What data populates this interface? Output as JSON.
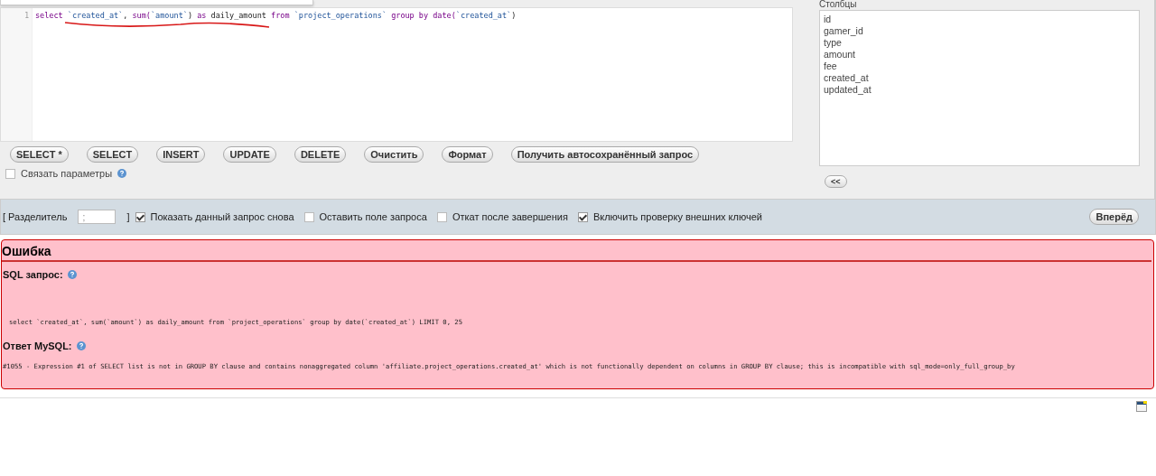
{
  "editor": {
    "line_number": "1",
    "tokens": [
      {
        "kind": "keyword",
        "text": "select "
      },
      {
        "kind": "ident",
        "text": "`created_at`"
      },
      {
        "kind": "plain",
        "text": ", "
      },
      {
        "kind": "keyword",
        "text": "sum("
      },
      {
        "kind": "ident",
        "text": "`amount`"
      },
      {
        "kind": "plain",
        "text": ") "
      },
      {
        "kind": "keyword",
        "text": "as "
      },
      {
        "kind": "plain",
        "text": "daily_amount "
      },
      {
        "kind": "keyword",
        "text": "from "
      },
      {
        "kind": "ident",
        "text": "`project_operations`"
      },
      {
        "kind": "keyword",
        "text": " group by "
      },
      {
        "kind": "keyword",
        "text": "date("
      },
      {
        "kind": "ident",
        "text": "`created_at`"
      },
      {
        "kind": "plain",
        "text": ")"
      }
    ]
  },
  "buttons": [
    "SELECT *",
    "SELECT",
    "INSERT",
    "UPDATE",
    "DELETE",
    "Очистить",
    "Формат",
    "Получить автосохранённый запрос"
  ],
  "bind_params": {
    "label": "Связать параметры",
    "checked": false
  },
  "columns_panel": {
    "label": "Столбцы",
    "items": [
      "id",
      "gamer_id",
      "type",
      "amount",
      "fee",
      "created_at",
      "updated_at"
    ],
    "insert_button": "<<"
  },
  "options_bar": {
    "delimiter_label": "[ Разделитель",
    "delimiter_value": ";",
    "delimiter_close": "]",
    "options": [
      {
        "label": "Показать данный запрос снова",
        "checked": true
      },
      {
        "label": "Оставить поле запроса",
        "checked": false
      },
      {
        "label": "Откат после завершения",
        "checked": false
      },
      {
        "label": "Включить проверку внешних ключей",
        "checked": true
      }
    ],
    "go_button": "Вперёд"
  },
  "error": {
    "title": "Ошибка",
    "query_label": "SQL запрос:",
    "query": "select `created_at`, sum(`amount`) as daily_amount from `project_operations` group by date(`created_at`) LIMIT 0, 25",
    "response_label": "Ответ MySQL:",
    "response": "#1055 - Expression #1 of SELECT list is not in GROUP BY clause and contains nonaggregated column 'affiliate.project_operations.created_at' which is not functionally dependent on columns in GROUP BY clause; this is incompatible with sql_mode=only_full_group_by"
  }
}
